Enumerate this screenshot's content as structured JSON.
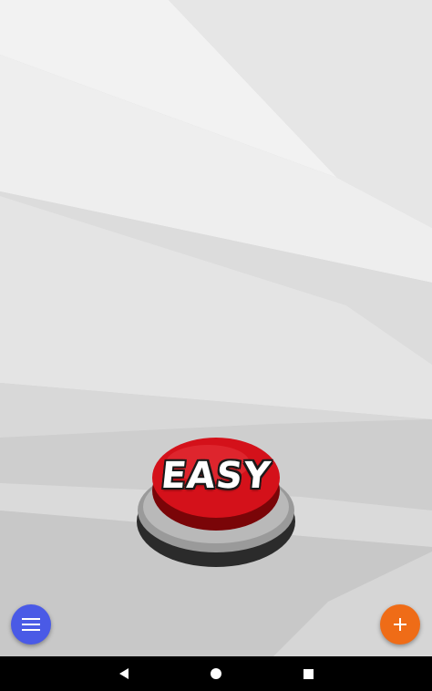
{
  "app": {
    "button_label": "EASY"
  },
  "actions": {
    "menu_icon": "menu-icon",
    "add_icon": "plus-icon",
    "menu_color": "#4a5ae6",
    "add_color": "#ef6c17"
  },
  "navbar": {
    "back_icon": "back-icon",
    "home_icon": "home-icon",
    "recent_icon": "recent-apps-icon"
  },
  "colors": {
    "button_red": "#d4111a",
    "navbar": "#000000"
  }
}
